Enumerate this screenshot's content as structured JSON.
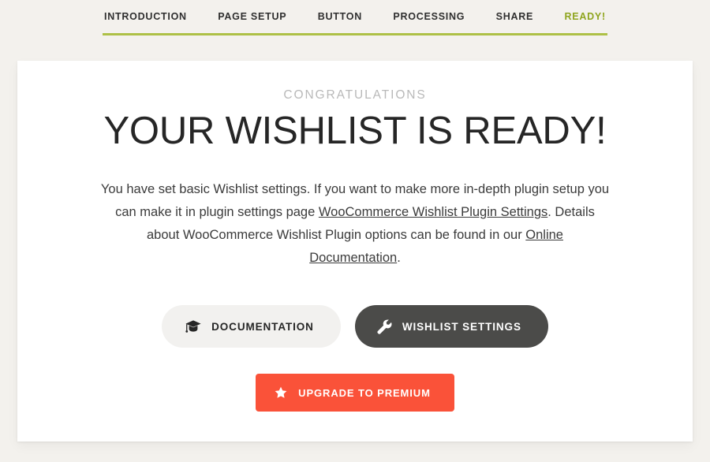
{
  "wizard": {
    "steps": [
      {
        "label": "INTRODUCTION",
        "active": false
      },
      {
        "label": "PAGE SETUP",
        "active": false
      },
      {
        "label": "BUTTON",
        "active": false
      },
      {
        "label": "PROCESSING",
        "active": false
      },
      {
        "label": "SHARE",
        "active": false
      },
      {
        "label": "READY!",
        "active": true
      }
    ],
    "active_color": "#8fa51f",
    "underline_color": "#adc046"
  },
  "card": {
    "eyebrow": "CONGRATULATIONS",
    "heading": "YOUR WISHLIST IS READY!",
    "description": {
      "part1": "You have set basic Wishlist settings. If you want to make more in-depth plugin setup you can make it in plugin settings page ",
      "link1": "WooCommerce Wishlist Plugin Settings",
      "part2": ". Details about WooCommerce Wishlist Plugin options can be found in our ",
      "link2": "Online Documentation",
      "part3": "."
    }
  },
  "actions": {
    "documentation": {
      "label": "DOCUMENTATION",
      "icon": "graduation-cap-icon",
      "background": "#f2f1ef",
      "color": "#262626"
    },
    "wishlist_settings": {
      "label": "WISHLIST SETTINGS",
      "icon": "wrench-icon",
      "background": "#4b4b49",
      "color": "#ffffff"
    },
    "upgrade": {
      "label": "UPGRADE TO PREMIUM",
      "icon": "star-icon",
      "background": "#fa5239",
      "color": "#ffffff"
    }
  },
  "theme": {
    "page_background": "#f3f1ed",
    "card_background": "#ffffff",
    "eyebrow_color": "#b9b9b9",
    "heading_color": "#262626",
    "text_color": "#3b3b3b"
  }
}
